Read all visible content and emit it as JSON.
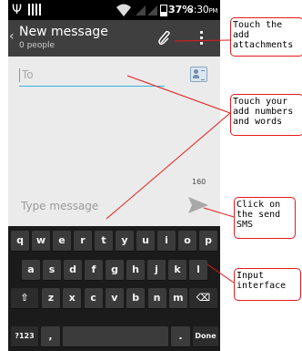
{
  "status_bar": {
    "usb_icon": "usb-icon",
    "battery": "37%",
    "time": "8:30",
    "time_suffix": "PM"
  },
  "action_bar": {
    "back_icon": "chevron-left-icon",
    "title": "New message",
    "subtitle": "0 people",
    "attach_icon": "paperclip-icon",
    "menu_icon": "overflow-menu-icon"
  },
  "compose": {
    "to_placeholder": "To",
    "contact_icon": "contact-card-icon",
    "char_counter": "160",
    "message_placeholder": "Type message",
    "send_icon": "send-arrow-icon"
  },
  "keyboard": {
    "row1": [
      "q",
      "w",
      "e",
      "r",
      "t",
      "y",
      "u",
      "i",
      "o",
      "p"
    ],
    "row2": [
      "a",
      "s",
      "d",
      "f",
      "g",
      "h",
      "j",
      "k",
      "l"
    ],
    "row3": [
      "z",
      "x",
      "c",
      "v",
      "b",
      "n",
      "m"
    ],
    "shift_icon": "shift-arrow-icon",
    "backspace_icon": "backspace-icon",
    "symbols_label": "?123",
    "comma_label": ",",
    "period_label": ".",
    "done_label": "Done"
  },
  "annotations": {
    "attach": "Touch the\nadd\nattachments",
    "numbers": "Touch your\nadd numbers\nand words",
    "send": "Click on\nthe send\nSMS",
    "input": "Input\ninterface"
  },
  "colors": {
    "accent": "#33b5e5",
    "callout_border": "#e41a1a",
    "action_bar": "#3f3f3f",
    "keyboard_bg": "#1b1b1b"
  }
}
